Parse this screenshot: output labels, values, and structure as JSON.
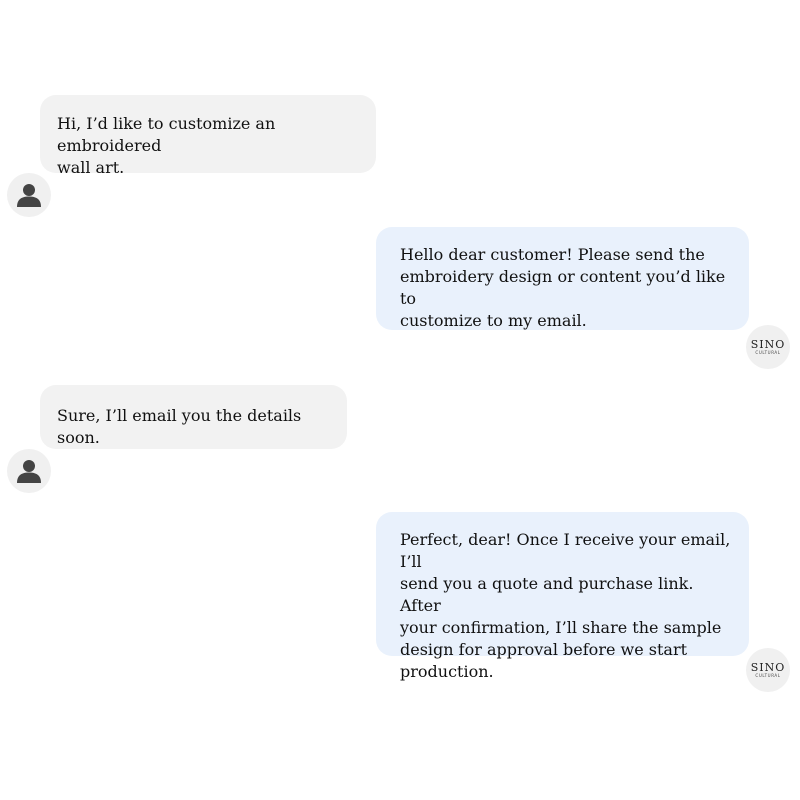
{
  "messages": [
    {
      "sender": "user",
      "text": "Hi, I’d like to customize an embroidered\nwall art."
    },
    {
      "sender": "agent",
      "text": "Hello dear customer! Please send the\nembroidery design or content you’d like to\ncustomize to my email."
    },
    {
      "sender": "user",
      "text": "Sure, I’ll email you the details soon."
    },
    {
      "sender": "agent",
      "text": "Perfect, dear! Once I receive your email, I’ll\nsend you a quote and purchase link. After\nyour confirmation, I’ll share the sample\ndesign for approval before we start\nproduction."
    }
  ],
  "agent_logo": {
    "main": "SINO",
    "sub": "CULTURAL"
  },
  "colors": {
    "user_bubble": "#f2f2f2",
    "agent_bubble": "#e9f1fc",
    "avatar_bg": "#f0f0f0",
    "user_icon": "#444444"
  },
  "icons": {
    "user_avatar": "person-icon",
    "agent_avatar": "sino-cultural-logo"
  }
}
